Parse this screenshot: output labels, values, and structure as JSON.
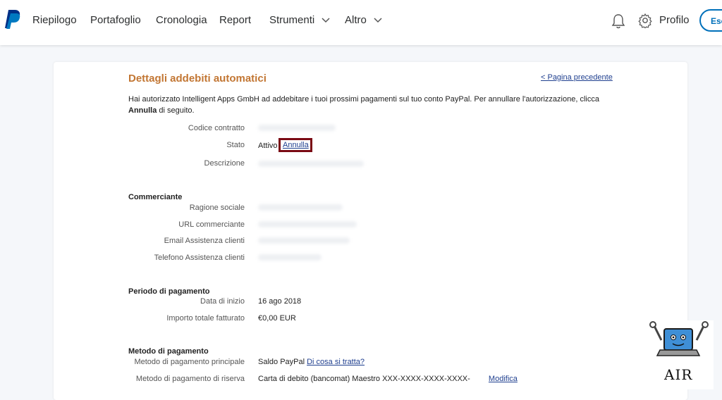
{
  "header": {
    "nav": [
      {
        "label": "Riepilogo"
      },
      {
        "label": "Portafoglio"
      },
      {
        "label": "Cronologia"
      },
      {
        "label": "Report"
      },
      {
        "label": "Strumenti"
      },
      {
        "label": "Altro"
      }
    ],
    "profile_label": "Profilo",
    "logout_label": "Esc"
  },
  "page": {
    "title": "Dettagli addebiti automatici",
    "back_link": "< Pagina precedente",
    "intro_text_1": "Hai autorizzato Intelligent Apps GmbH ad addebitare i tuoi prossimi pagamenti sul tuo conto PayPal. Per annullare l'autorizzazione, clicca",
    "intro_bold": "Annulla",
    "intro_text_2": " di seguito."
  },
  "details": {
    "contract_label": "Codice contratto",
    "status_label": "Stato",
    "status_value": "Attivo",
    "cancel_link": "Annulla",
    "description_label": "Descrizione"
  },
  "merchant": {
    "heading": "Commerciante",
    "company_label": "Ragione sociale",
    "url_label": "URL commerciante",
    "email_label": "Email Assistenza clienti",
    "phone_label": "Telefono Assistenza clienti"
  },
  "period": {
    "heading": "Periodo di pagamento",
    "start_label": "Data di inizio",
    "start_value": "16 ago 2018",
    "total_label": "Importo totale fatturato",
    "total_value": "€0,00 EUR"
  },
  "payment": {
    "heading": "Metodo di pagamento",
    "primary_label": "Metodo di pagamento principale",
    "primary_value": "Saldo PayPal",
    "primary_link": "Di cosa si tratta?",
    "backup_label": "Metodo di pagamento di riserva",
    "backup_value": "Carta di debito (bancomat) Maestro XXX-XXXX-XXXX-XXXX-",
    "backup_link": "Modifica"
  },
  "watermark": {
    "text": "AIR"
  },
  "colors": {
    "accent": "#0070ba",
    "title": "#c27633",
    "highlight_box": "#7a0a14",
    "link": "#1f3f8f"
  }
}
